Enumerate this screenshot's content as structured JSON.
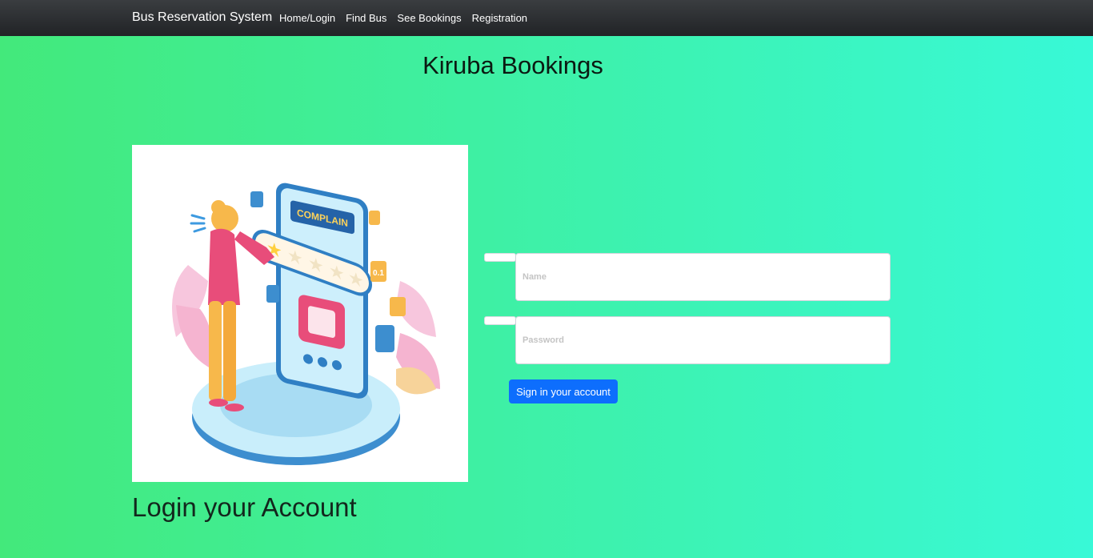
{
  "navbar": {
    "brand": "Bus Reservation System",
    "links": [
      "Home/Login",
      "Find Bus",
      "See Bookings",
      "Registration"
    ]
  },
  "page": {
    "heading": "Kiruba Bookings",
    "subheading": "Login your Account"
  },
  "illustration": {
    "banner_text": "COMPLAIN",
    "badge_text": "0.1"
  },
  "form": {
    "name_placeholder": "Name",
    "password_placeholder": "Password",
    "submit_label": "Sign in your account"
  },
  "colors": {
    "bg_start": "#43e97b",
    "bg_end": "#38f9d7",
    "navbar": "#212326",
    "button": "#0d6efd"
  }
}
